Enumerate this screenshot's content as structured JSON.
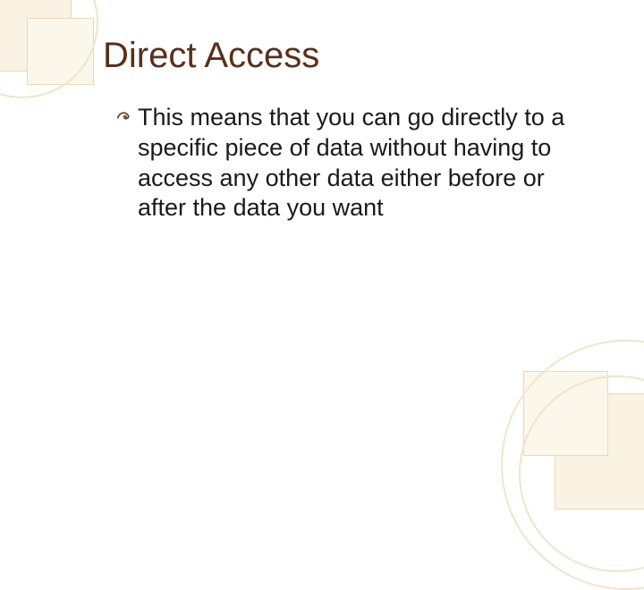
{
  "slide": {
    "title": "Direct Access",
    "bullets": [
      {
        "text": "This means that you can go directly to a specific piece of data without having to access any other data either before or after the data you want"
      }
    ]
  },
  "theme": {
    "title_color": "#5a2f1a",
    "text_color": "#1a1a1a",
    "accent_light": "#faf3e3",
    "accent_border": "#e8d9b5"
  }
}
